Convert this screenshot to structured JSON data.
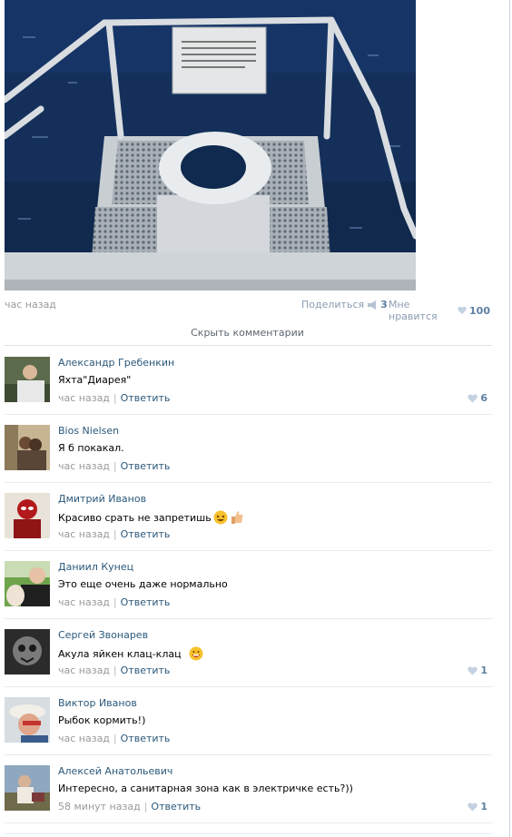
{
  "post": {
    "time": "час назад",
    "share_label": "Поделиться",
    "share_count": "3",
    "like_label": "Мне нравится",
    "like_count": "100",
    "hide_comments": "Скрыть комментарии"
  },
  "comments": [
    {
      "author": "Александр Гребенкин",
      "text": "Яхта\"Диарея\"",
      "time": "час назад",
      "reply": "Ответить",
      "likes": "6"
    },
    {
      "author": "Bios Nielsen",
      "text": "Я б покакал.",
      "time": "час назад",
      "reply": "Ответить",
      "likes": ""
    },
    {
      "author": "Дмитрий Иванов",
      "text": "Красиво срать не запретишь",
      "time": "час назад",
      "reply": "Ответить",
      "likes": ""
    },
    {
      "author": "Даниил Кунец",
      "text": "Это еще очень даже нормально",
      "time": "час назад",
      "reply": "Ответить",
      "likes": ""
    },
    {
      "author": "Сергей Звонарев",
      "text": "Акула яйкен клац-клац",
      "time": "час назад",
      "reply": "Ответить",
      "likes": "1"
    },
    {
      "author": "Виктор Иванов",
      "text": "Рыбок кормить!)",
      "time": "час назад",
      "reply": "Ответить",
      "likes": ""
    },
    {
      "author": "Алексей Анатольевич",
      "text": "Интересно, а санитарная зона как в электричке есть?))",
      "time": "58 минут назад",
      "reply": "Ответить",
      "likes": "1"
    }
  ],
  "colors": {
    "link": "#2b587a",
    "muted": "#999999",
    "like": "#5e7fa3"
  }
}
